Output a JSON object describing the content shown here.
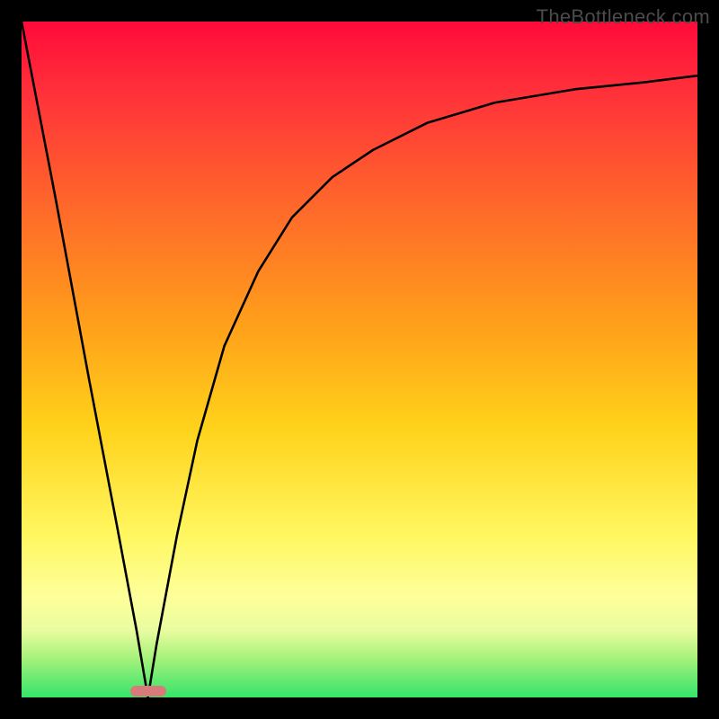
{
  "watermark": "TheBottleneck.com",
  "chart_data": {
    "type": "line",
    "title": "",
    "xlabel": "",
    "ylabel": "",
    "xlim": [
      0,
      100
    ],
    "ylim": [
      0,
      100
    ],
    "grid": false,
    "legend": false,
    "series": [
      {
        "name": "bottleneck-curve",
        "x": [
          0,
          5,
          10,
          14,
          17,
          18.7,
          20,
          23,
          26,
          30,
          35,
          40,
          46,
          52,
          60,
          70,
          82,
          92,
          100
        ],
        "values": [
          100,
          74,
          47,
          26,
          10,
          0,
          8,
          24,
          38,
          52,
          63,
          71,
          77,
          81,
          85,
          88,
          90,
          91,
          92
        ]
      }
    ],
    "marker": {
      "name": "optimal-point",
      "x": 18.7,
      "y": 0,
      "color": "#d87a7a"
    },
    "background_gradient": {
      "top": "#ff0a3a",
      "upper_mid": "#ffa01a",
      "mid": "#fff760",
      "bottom": "#35e46a"
    }
  }
}
